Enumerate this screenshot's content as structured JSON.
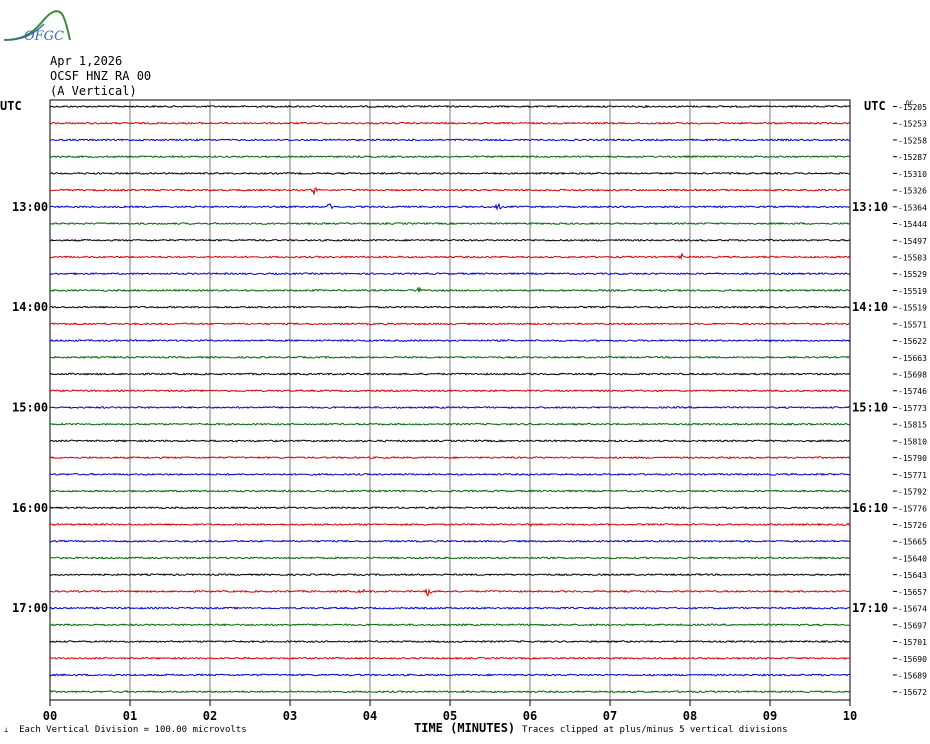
{
  "header": {
    "logo_text": "OFGC",
    "date": "Apr 1,2026",
    "station": "OCSF HNZ RA 00",
    "component": "(A Vertical)"
  },
  "labels": {
    "utc_left": "UTC",
    "utc_right": "UTC",
    "dc_label": "DC"
  },
  "footer": {
    "scale_text": "Each Vertical Division =  100.00 microvolts",
    "x_title": "TIME (MINUTES)",
    "clip_text": "Traces clipped at plus/minus 5 vertical divisions"
  },
  "colors": {
    "cycle": [
      "#000000",
      "#d40000",
      "#0000cc",
      "#006600"
    ],
    "grid": "#7a7a7a"
  },
  "chart_data": {
    "type": "line",
    "title": "Apr 1,2026 OCSF HNZ RA 00 (A Vertical)",
    "xlabel": "TIME (MINUTES)",
    "xlim": [
      0,
      10
    ],
    "x_ticks": [
      "00",
      "01",
      "02",
      "03",
      "04",
      "05",
      "06",
      "07",
      "08",
      "09",
      "10"
    ],
    "grid": true,
    "left_time_labels": [
      {
        "trace": 6,
        "label": "13:00"
      },
      {
        "trace": 12,
        "label": "14:00"
      },
      {
        "trace": 18,
        "label": "15:00"
      },
      {
        "trace": 24,
        "label": "16:00"
      },
      {
        "trace": 30,
        "label": "17:00"
      }
    ],
    "right_time_labels": [
      {
        "trace": 6,
        "label": "13:10"
      },
      {
        "trace": 12,
        "label": "14:10"
      },
      {
        "trace": 18,
        "label": "15:10"
      },
      {
        "trace": 24,
        "label": "16:10"
      },
      {
        "trace": 30,
        "label": "17:10"
      }
    ],
    "dc_offsets": [
      -15205,
      -15253,
      -15258,
      -15287,
      -15310,
      -15326,
      -15364,
      -15444,
      -15497,
      -15503,
      -15529,
      -15519,
      -15519,
      -15571,
      -15622,
      -15663,
      -15698,
      -15746,
      -15773,
      -15815,
      -15810,
      -15790,
      -15771,
      -15792,
      -15776,
      -15726,
      -15665,
      -15640,
      -15643,
      -15657,
      -15674,
      -15697,
      -15701,
      -15690,
      -15689,
      -15672
    ],
    "events": [
      {
        "trace": 5,
        "minute": 3.3,
        "amp": 4
      },
      {
        "trace": 6,
        "minute": 3.5,
        "amp": 5
      },
      {
        "trace": 6,
        "minute": 5.6,
        "amp": 4
      },
      {
        "trace": 9,
        "minute": 7.9,
        "amp": 3
      },
      {
        "trace": 11,
        "minute": 4.6,
        "amp": 4
      },
      {
        "trace": 25,
        "minute": 6.0,
        "amp": 3
      },
      {
        "trace": 25,
        "minute": 9.95,
        "amp": 3
      },
      {
        "trace": 29,
        "minute": 4.74,
        "amp": 8
      },
      {
        "trace": 29,
        "minute": 3.9,
        "amp": 3
      }
    ]
  }
}
